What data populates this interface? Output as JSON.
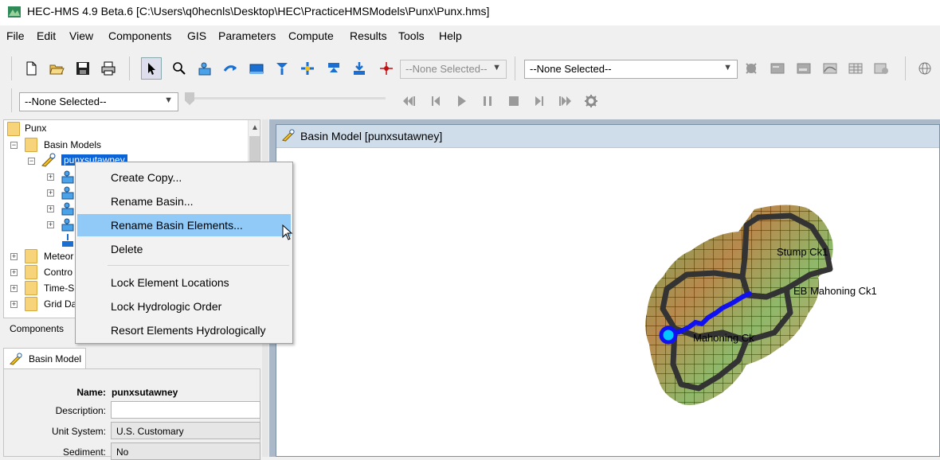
{
  "window": {
    "title": "HEC-HMS 4.9 Beta.6 [C:\\Users\\q0hecnls\\Desktop\\HEC\\PracticeHMSModels\\Punx\\Punx.hms]"
  },
  "menu": [
    "File",
    "Edit",
    "View",
    "Components",
    "GIS",
    "Parameters",
    "Compute",
    "Results",
    "Tools",
    "Help"
  ],
  "toolbar": {
    "element_combo": "--None Selected--",
    "run_combo": "--None Selected--",
    "time_combo": "--None Selected--"
  },
  "tree": {
    "root": "Punx",
    "basin_models": "Basin Models",
    "selected_basin": "punxsutawney",
    "meteor": "Meteor",
    "control": "Contro",
    "time_series": "Time-S",
    "grid_data": "Grid Da"
  },
  "context_menu": {
    "items": [
      "Create Copy...",
      "Rename Basin...",
      "Rename Basin Elements...",
      "Delete",
      "Lock Element Locations",
      "Lock Hydrologic Order",
      "Resort Elements Hydrologically"
    ],
    "highlighted_index": 2
  },
  "tabs": {
    "components": "Components"
  },
  "properties": {
    "tab": "Basin Model",
    "name_label": "Name:",
    "name_value": "punxsutawney",
    "description_label": "Description:",
    "description_value": "",
    "unit_label": "Unit System:",
    "unit_value": "U.S. Customary",
    "sediment_label": "Sediment:",
    "sediment_value": "No"
  },
  "map": {
    "title": "Basin Model [punxsutawney]",
    "labels": {
      "stump": "Stump Ck1",
      "eb": "EB Mahoning Ck1",
      "mahoning": "Mahoning Ck"
    },
    "colors": {
      "reach": "#1010f0",
      "boundary": "#333333",
      "highlight": "#91c9f7"
    }
  }
}
